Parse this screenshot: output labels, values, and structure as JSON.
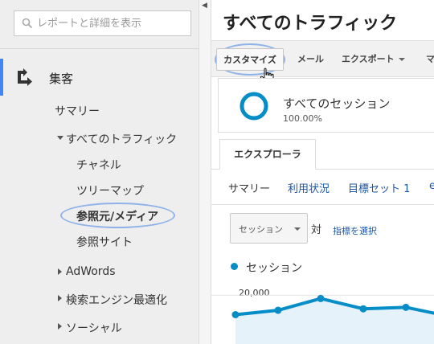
{
  "sidebar": {
    "search_placeholder": "レポートと詳細を表示",
    "section_label": "集客",
    "items": {
      "summary": "サマリー",
      "all_traffic": "すべてのトラフィック",
      "channels": "チャネル",
      "treemap": "ツリーマップ",
      "source_medium": "参照元/メディア",
      "referrals": "参照サイト",
      "adwords": "AdWords",
      "seo": "検索エンジン最適化",
      "social": "ソーシャル"
    }
  },
  "main": {
    "title": "すべてのトラフィック",
    "toolbar": {
      "customize": "カスタマイズ",
      "email": "メール",
      "export": "エクスポート",
      "more": "マ"
    },
    "segment": {
      "name": "すべてのセッション",
      "percent": "100.00%"
    },
    "tab_explorer": "エクスプローラ",
    "subnav": {
      "summary": "サマリー",
      "usage": "利用状況",
      "goal_set": "目標セット 1",
      "more": "e"
    },
    "metric_select": "セッション",
    "vs_label": "対",
    "pick_metric": "指標を選択"
  },
  "chart_data": {
    "type": "line",
    "series": [
      {
        "name": "セッション",
        "values": [
          19500,
          19650,
          20050,
          19700,
          19750,
          19450
        ]
      }
    ],
    "y_ticks": [
      "20,000"
    ],
    "color": "#058dc7",
    "fill": "#e6f2fa",
    "ylim": [
      18500,
      20500
    ],
    "grid": true
  },
  "colors": {
    "accent": "#4285f4",
    "link": "#1a56a8",
    "series": "#058dc7"
  }
}
